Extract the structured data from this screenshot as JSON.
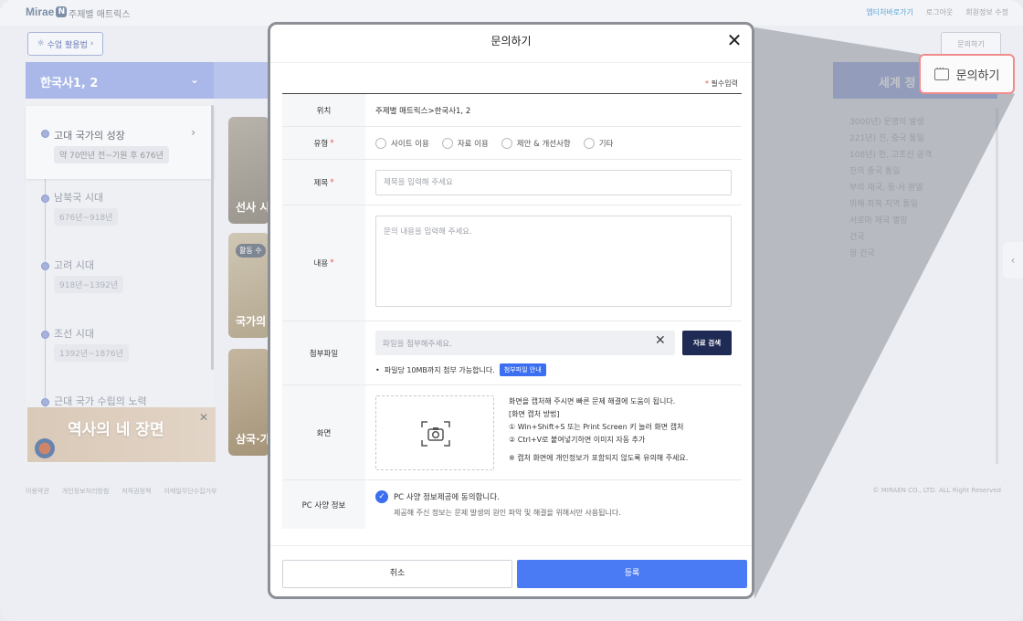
{
  "topbar": {
    "logo": "Mirae",
    "logo_badge": "N",
    "site_title": "주제별 매트릭스",
    "links": [
      "엠티처바로가기",
      "로그아웃",
      "회원정보 수정"
    ]
  },
  "toolbar": {
    "usage_button": "수업 활용법",
    "inquiry_button": "문의하기"
  },
  "left_panel": {
    "header": "한국사1, 2",
    "timeline": [
      {
        "name": "고대 국가의 성장",
        "range": "약 70만년 전~기원 후 676년"
      },
      {
        "name": "남북국 시대",
        "range": "676년~918년"
      },
      {
        "name": "고려 시대",
        "range": "918년~1392년"
      },
      {
        "name": "조선 시대",
        "range": "1392년~1876년"
      },
      {
        "name": "근대 국가 수립의 노력",
        "range": ""
      }
    ]
  },
  "cards": [
    {
      "title": "선사 시",
      "tag": ""
    },
    {
      "title": "국가의",
      "tag": "활동 수"
    },
    {
      "title": "삼국·가",
      "tag": ""
    }
  ],
  "banner": {
    "title": "역사의 네 장면"
  },
  "right_panel": {
    "header": "세계 정",
    "items": [
      "3000년) 문명의 발생",
      "221년) 진, 중국 통일",
      "108년) 한, 고조선 공격",
      "진의 중국 통일",
      "부의 재국, 동·서 분열",
      "위해·화북 지역 통일",
      "서로마 제국 멸망",
      "건국",
      "왕 건국"
    ]
  },
  "footer": {
    "links": [
      "이용약관",
      "개인정보처리방침",
      "저작권정책",
      "이메일무단수집거부"
    ],
    "copyright": "© MIRAEN CO., LTD. ALL Right Reserved"
  },
  "callout": {
    "label": "문의하기"
  },
  "modal": {
    "title": "문의하기",
    "required_note": "필수입력",
    "location": {
      "label": "위치",
      "value": "주제별 매트릭스>한국사1, 2"
    },
    "type": {
      "label": "유형",
      "options": [
        "사이트 이용",
        "자료 이용",
        "제안 & 개선사항",
        "기타"
      ]
    },
    "subject": {
      "label": "제목",
      "placeholder": "제목을 입력해 주세요"
    },
    "content": {
      "label": "내용",
      "placeholder": "문의 내용을 입력해 주세요."
    },
    "attachment": {
      "label": "첨부파일",
      "placeholder": "파일을 첨부해주세요.",
      "search_button": "자료 검색",
      "note": "파일당 10MB까지 첨부 가능합니다.",
      "guide_badge": "첨부파일 안내"
    },
    "screen": {
      "label": "화면",
      "line1": "화면을 캡처해 주시면 빠른 문제 해결에 도움이 됩니다.",
      "line2": "[화면 캡처 방법]",
      "line3": "① Win+Shift+S 또는 Print Screen 키 눌러 화면 캡처",
      "line4": "② Ctrl+V로 붙여넣기하면 이미지 자동 추가",
      "warning": "※ 캡처 화면에 개인정보가 포함되지 않도록 유의해 주세요."
    },
    "pc_info": {
      "label": "PC 사양 정보",
      "agree": "PC 사양 정보제공에 동의합니다.",
      "desc": "제공해 주신 정보는 문제 발생의 원인 파악 및 해결을 위해서만 사용됩니다."
    },
    "cancel_button": "취소",
    "submit_button": "등록"
  }
}
